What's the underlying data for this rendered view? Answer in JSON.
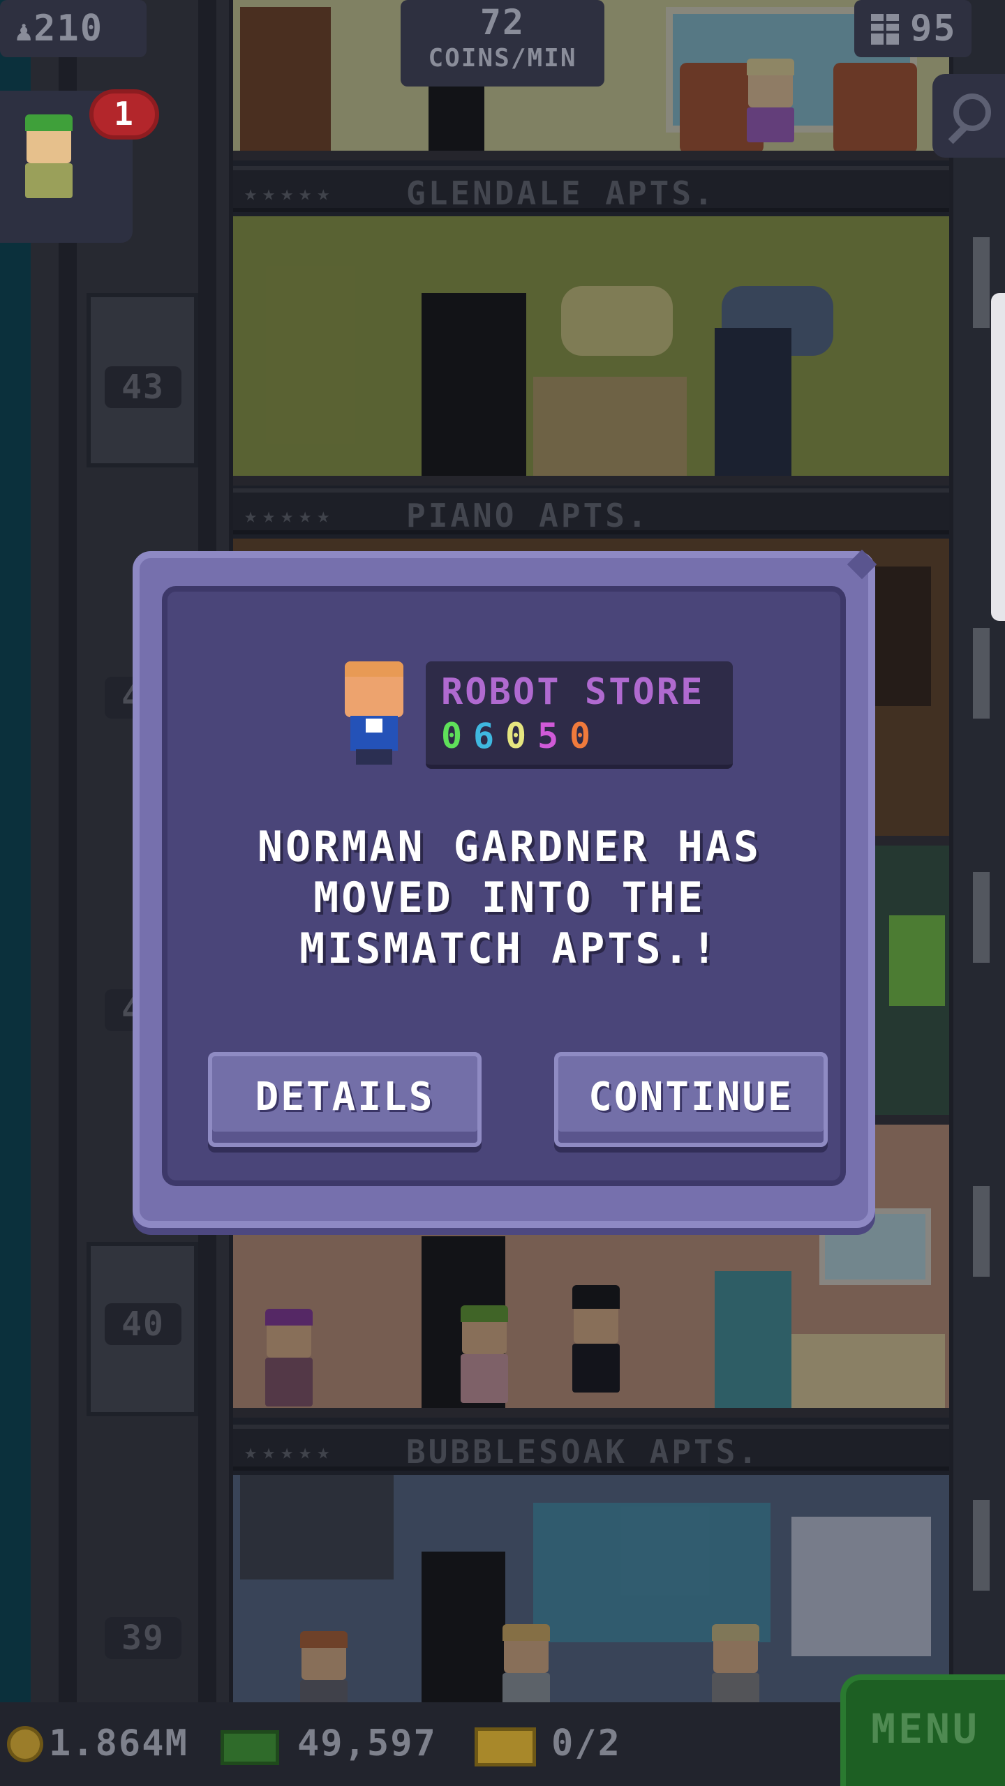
{
  "hud": {
    "population": "210",
    "coins_per_min_value": "72",
    "coins_per_min_unit": "COINS/MIN",
    "floor_count": "95",
    "visitor_badge": "1"
  },
  "tower": {
    "floors": [
      {
        "name": "GLENDALE APTS.",
        "stars": "★★★★★"
      },
      {
        "name": "PIANO APTS.",
        "stars": "★★★★★"
      },
      {
        "name": "BUBBLESOAK APTS.",
        "stars": "★★★★★"
      }
    ],
    "floor_numbers": [
      "43",
      "42",
      "41",
      "40",
      "39"
    ]
  },
  "modal": {
    "store_name": "ROBOT STORE",
    "store_digits": [
      {
        "digit": "0",
        "color": "#5fe05a"
      },
      {
        "digit": "6",
        "color": "#3fb8e0"
      },
      {
        "digit": "0",
        "color": "#e6e680"
      },
      {
        "digit": "5",
        "color": "#d05ad8"
      },
      {
        "digit": "0",
        "color": "#f07a3c"
      }
    ],
    "message": "NORMAN GARDNER HAS MOVED INTO THE MISMATCH APTS.!",
    "details_label": "DETAILS",
    "continue_label": "CONTINUE"
  },
  "bottom_bar": {
    "coins": "1.864M",
    "tower_bux": "49,597",
    "tickets": "0/2",
    "menu_label": "MENU"
  },
  "icons": {
    "population": "person-icon",
    "floors": "building-grid-icon",
    "search": "search-icon",
    "coins": "coin-icon",
    "bux": "bux-icon",
    "tickets": "ticket-icon"
  },
  "colors": {
    "modal_bg": "#4a4579",
    "modal_frame": "#7670ad",
    "store_name": "#b06ad0",
    "menu_green": "#1d5f23"
  }
}
